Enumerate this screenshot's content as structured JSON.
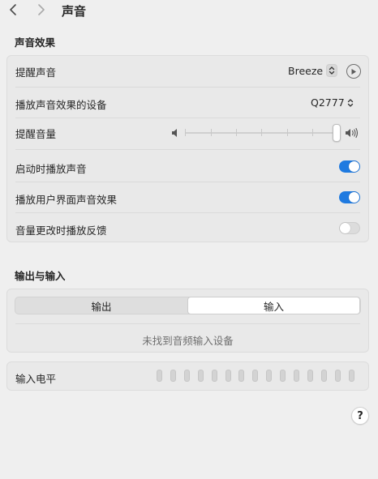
{
  "window": {
    "title": "声音",
    "back_icon": "chevron-left-icon",
    "forward_icon": "chevron-right-icon"
  },
  "sound_effects": {
    "section_title": "声音效果",
    "alert_sound": {
      "label": "提醒声音",
      "value": "Breeze"
    },
    "output_device": {
      "label": "播放声音效果的设备",
      "value": "Q2777"
    },
    "alert_volume": {
      "label": "提醒音量",
      "level": 1.0
    },
    "startup_sound": {
      "label": "启动时播放声音",
      "enabled": true
    },
    "ui_sound_effects": {
      "label": "播放用户界面声音效果",
      "enabled": true
    },
    "volume_feedback": {
      "label": "音量更改时播放反馈",
      "enabled": false
    }
  },
  "output_input": {
    "section_title": "输出与输入",
    "tabs": [
      {
        "label": "输出",
        "selected": false
      },
      {
        "label": "输入",
        "selected": true
      }
    ],
    "empty_message": "未找到音频输入设备",
    "input_level": {
      "label": "输入电平",
      "level": 0
    }
  },
  "help_label": "?",
  "colors": {
    "accent": "#1f7ae0",
    "background": "#efefef",
    "group_background": "#e9e9e9"
  }
}
